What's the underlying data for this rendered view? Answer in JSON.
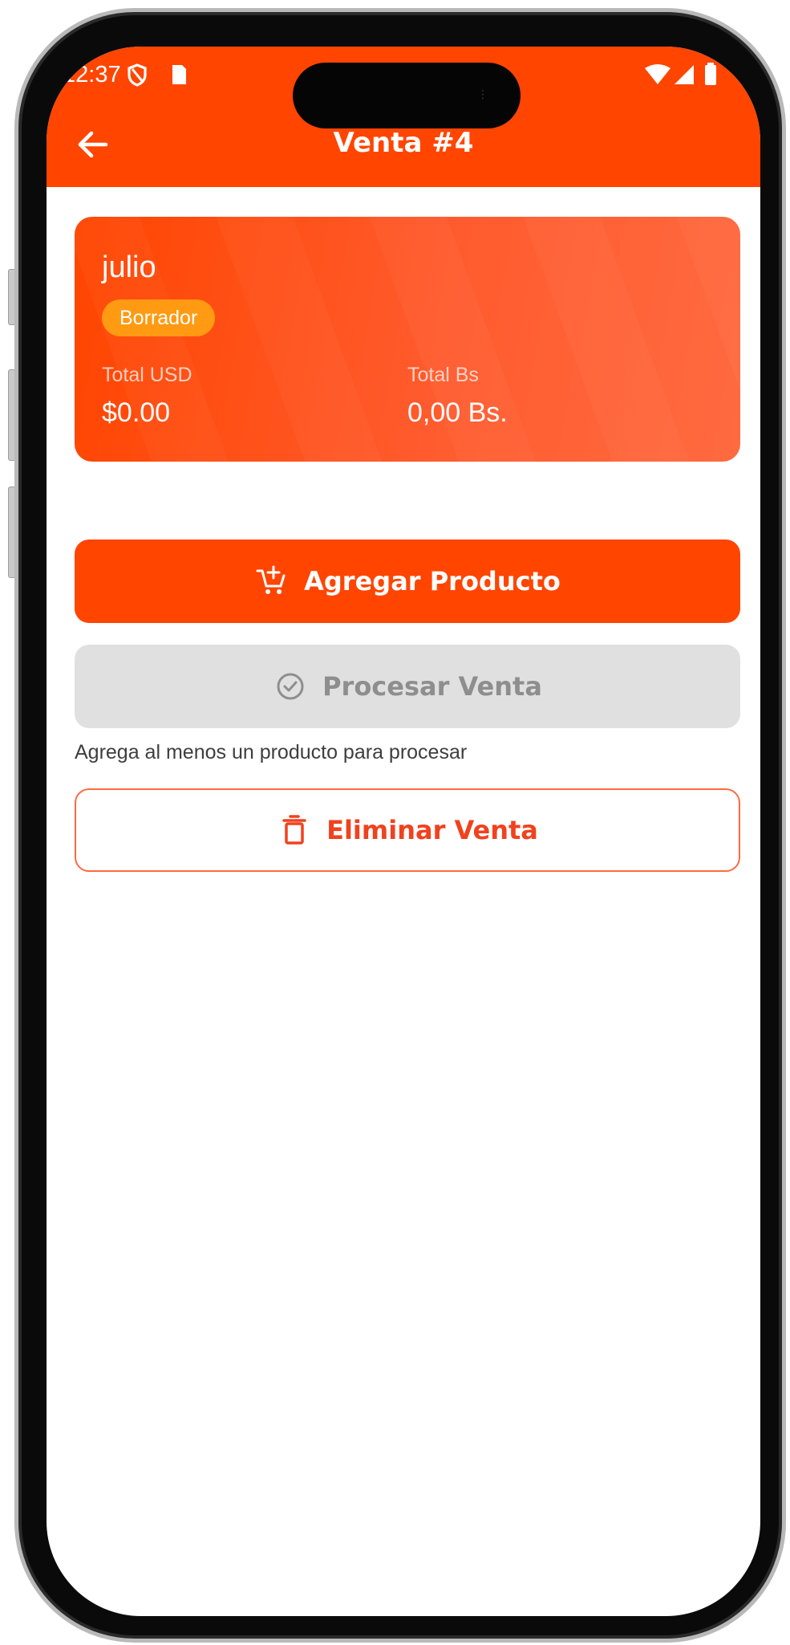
{
  "status_bar": {
    "time": "12:37",
    "icons": [
      "shield-icon",
      "sim-card-icon",
      "wifi-icon",
      "signal-icon",
      "battery-icon"
    ]
  },
  "app_bar": {
    "title": "Venta #4",
    "back_icon": "arrow-left-icon",
    "color": "#ff4500"
  },
  "summary": {
    "client_name": "julio",
    "status": "Borrador",
    "total_usd_label": "Total USD",
    "total_usd_value": "$0.00",
    "total_bs_label": "Total Bs",
    "total_bs_value": "0,00 Bs.",
    "badge_color": "#ff9a12"
  },
  "actions": {
    "add_product": {
      "label": "Agregar Producto",
      "icon": "cart-plus-icon"
    },
    "process_sale": {
      "label": "Procesar Venta",
      "icon": "check-circle-icon",
      "disabled": true
    },
    "process_hint": "Agrega al menos un producto para procesar",
    "delete_sale": {
      "label": "Eliminar Venta",
      "icon": "trash-icon"
    }
  },
  "colors": {
    "primary": "#ff4500",
    "disabled_bg": "#e0e0e0",
    "danger_text": "#f0421e"
  }
}
